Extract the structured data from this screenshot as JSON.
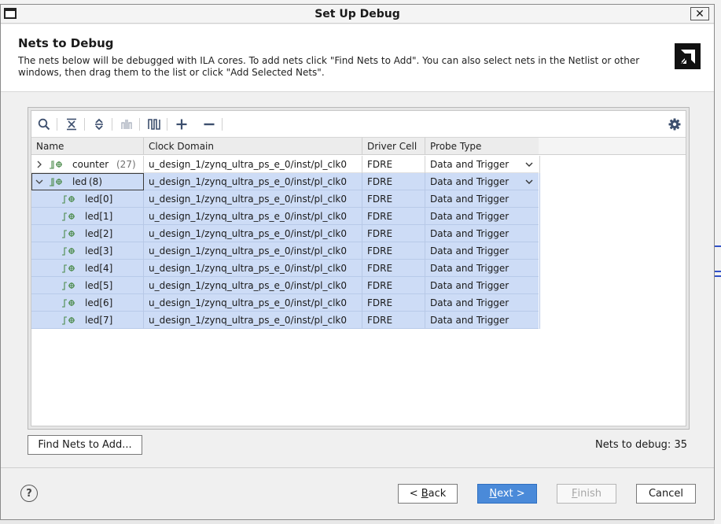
{
  "window": {
    "title": "Set Up Debug",
    "close_label": "✕"
  },
  "header": {
    "title": "Nets to Debug",
    "description": "The nets below will be debugged with ILA cores. To add nets click \"Find Nets to Add\". You can also select nets in the Netlist or other windows, then drag them to the list or click \"Add Selected Nets\"."
  },
  "toolbar": {
    "icons": [
      "search-icon",
      "collapse-all-icon",
      "expand-all-icon",
      "split-icon",
      "waveform-icon",
      "add-icon",
      "remove-icon",
      "gear-icon"
    ]
  },
  "table": {
    "columns": [
      "Name",
      "Clock Domain",
      "Driver Cell",
      "Probe Type"
    ],
    "rows": [
      {
        "name": "counter",
        "count": "(27)",
        "clock": "u_design_1/zynq_ultra_ps_e_0/inst/pl_clk0",
        "driver": "FDRE",
        "probe": "Data and Trigger"
      },
      {
        "name": "led",
        "count": "(8)",
        "clock": "u_design_1/zynq_ultra_ps_e_0/inst/pl_clk0",
        "driver": "FDRE",
        "probe": "Data and Trigger"
      },
      {
        "name": "led[0]",
        "clock": "u_design_1/zynq_ultra_ps_e_0/inst/pl_clk0",
        "driver": "FDRE",
        "probe": "Data and Trigger"
      },
      {
        "name": "led[1]",
        "clock": "u_design_1/zynq_ultra_ps_e_0/inst/pl_clk0",
        "driver": "FDRE",
        "probe": "Data and Trigger"
      },
      {
        "name": "led[2]",
        "clock": "u_design_1/zynq_ultra_ps_e_0/inst/pl_clk0",
        "driver": "FDRE",
        "probe": "Data and Trigger"
      },
      {
        "name": "led[3]",
        "clock": "u_design_1/zynq_ultra_ps_e_0/inst/pl_clk0",
        "driver": "FDRE",
        "probe": "Data and Trigger"
      },
      {
        "name": "led[4]",
        "clock": "u_design_1/zynq_ultra_ps_e_0/inst/pl_clk0",
        "driver": "FDRE",
        "probe": "Data and Trigger"
      },
      {
        "name": "led[5]",
        "clock": "u_design_1/zynq_ultra_ps_e_0/inst/pl_clk0",
        "driver": "FDRE",
        "probe": "Data and Trigger"
      },
      {
        "name": "led[6]",
        "clock": "u_design_1/zynq_ultra_ps_e_0/inst/pl_clk0",
        "driver": "FDRE",
        "probe": "Data and Trigger"
      },
      {
        "name": "led[7]",
        "clock": "u_design_1/zynq_ultra_ps_e_0/inst/pl_clk0",
        "driver": "FDRE",
        "probe": "Data and Trigger"
      }
    ]
  },
  "actions": {
    "find_nets_label": "Find Nets to Add...",
    "nets_to_debug": "Nets to debug: 35"
  },
  "footer": {
    "help_label": "?",
    "back_prefix": "< ",
    "back_mnemonic": "B",
    "back_rest": "ack",
    "next_mnemonic": "N",
    "next_rest": "ext >",
    "finish_mnemonic": "F",
    "finish_rest": "inish",
    "cancel_label": "Cancel"
  },
  "colors": {
    "selection": "#cddcf6",
    "primary_button": "#4a8ad9",
    "toolbar_icon": "#3d4f6e",
    "net_icon": "#4a8a4a"
  }
}
